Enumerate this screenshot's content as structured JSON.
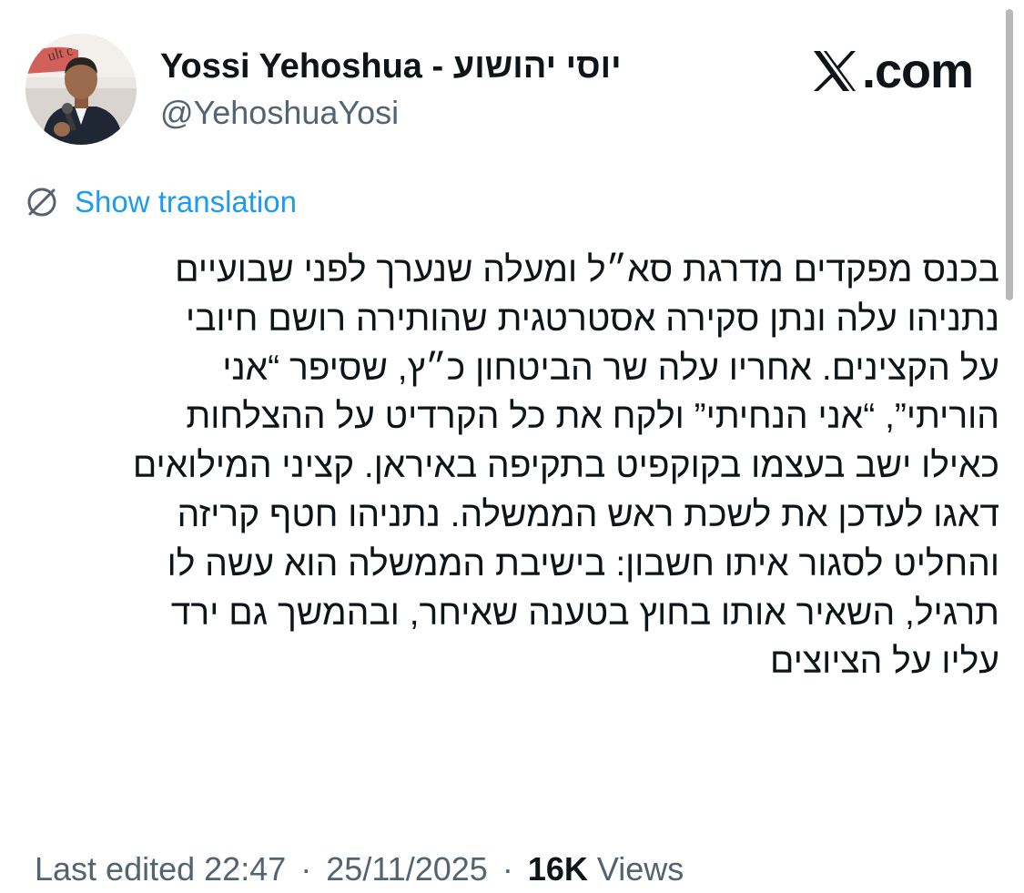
{
  "brand": {
    "name": "X",
    "domain_suffix": ".com"
  },
  "author": {
    "display_name": "Yossi Yehoshua - יוסי יהושוע",
    "handle": "@YehoshuaYosi",
    "avatar_icon": "profile-photo"
  },
  "translation": {
    "label": "Show translation",
    "icon": "translate-icon",
    "color": "#1d9bf0"
  },
  "tweet": {
    "lines": [
      "בכנס מפקדים מדרגת סא״ל ומעלה שנערך לפני שבועיים",
      "נתניהו עלה ונתן סקירה אסטרטגית שהותירה רושם חיובי",
      "על הקצינים. אחריו עלה שר הביטחון כ״ץ, שסיפר “אני",
      "הוריתי”, “אני הנחיתי” ולקח את כל הקרדיט על ההצלחות",
      "כאילו ישב בעצמו בקוקפיט בתקיפה באיראן. קציני המילואים",
      "דאגו לעדכן את לשכת ראש הממשלה. נתניהו חטף קריזה",
      "והחליט לסגור איתו חשבון: בישיבת הממשלה הוא עשה לו",
      "תרגיל, השאיר אותו בחוץ בטענה שאיחר, ובהמשך גם ירד",
      "עליו על הציוצים"
    ]
  },
  "meta": {
    "edited_label": "Last edited",
    "time": "22:47",
    "separator": "·",
    "date": "25/11/2025",
    "views_count": "16K",
    "views_label": "Views"
  },
  "colors": {
    "text": "#0f1419",
    "secondary": "#536471",
    "accent": "#1d9bf0"
  }
}
